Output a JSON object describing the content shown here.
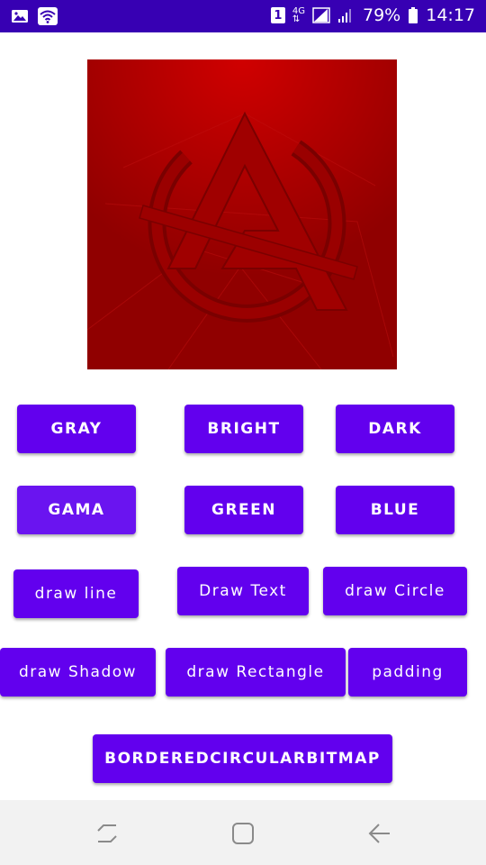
{
  "status_bar": {
    "left_icons": [
      "gallery-icon",
      "wifi-icon"
    ],
    "sim_slot": "1",
    "network_type": "4G",
    "battery_percent": "79%",
    "time": "14:17"
  },
  "image": {
    "icon": "avengers-logo-icon",
    "colors": {
      "background": "#b00000",
      "emblem": "#8a0000"
    }
  },
  "buttons": {
    "gray": "GRAY",
    "bright": "BRIGHT",
    "dark": "DARK",
    "gama": "GAMA",
    "green": "GREEN",
    "blue": "BLUE",
    "draw_line": "draw line",
    "draw_text": "Draw Text",
    "draw_circle": "draw Circle",
    "draw_shadow": "draw Shadow",
    "draw_rectangle": "draw Rectangle",
    "padding": "padding",
    "bordered_circular_bitmap": "BORDEREDCIRCULARBITMAP"
  },
  "nav_bar": {
    "icons": [
      "recents-icon",
      "home-icon",
      "back-icon"
    ]
  },
  "colors": {
    "status_bar": "#3700b3",
    "button": "#6200ee",
    "nav_bar": "#f2f2f2"
  }
}
